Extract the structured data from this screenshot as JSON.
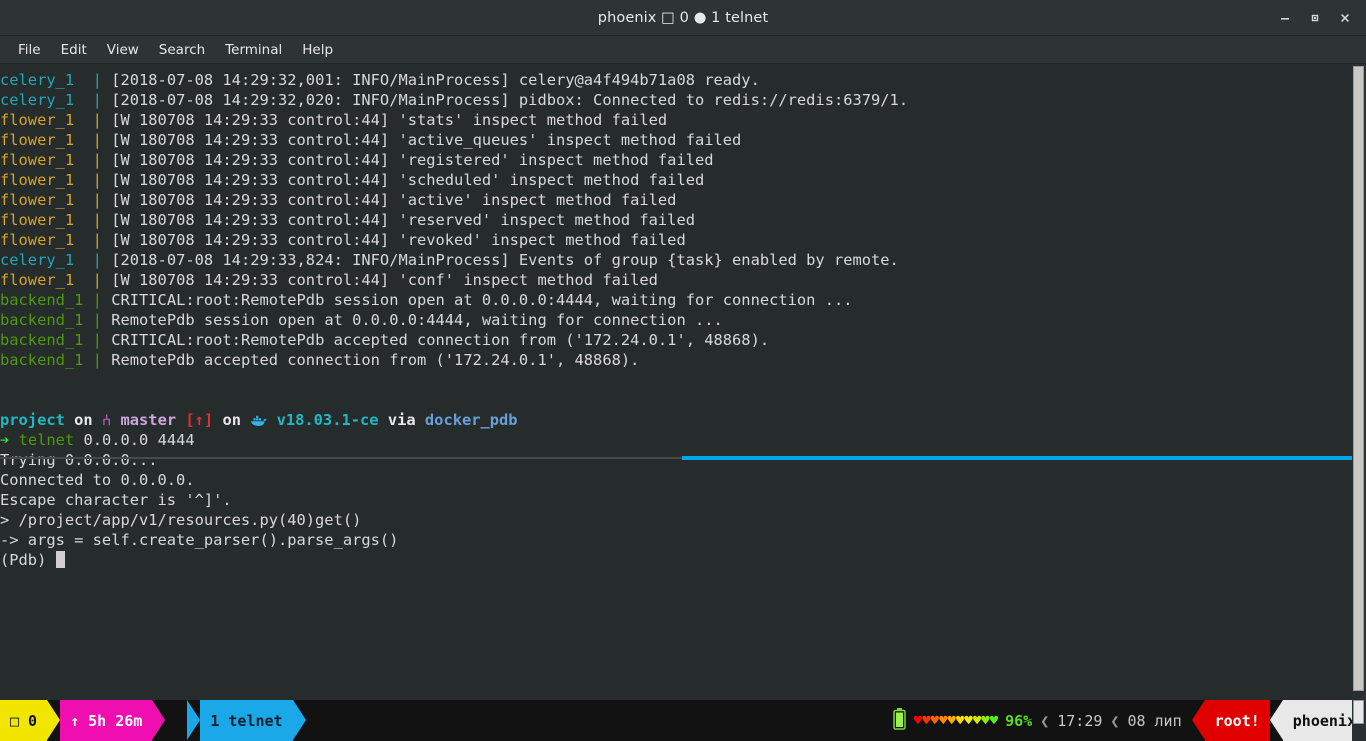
{
  "window": {
    "title": "phoenix □ 0 ● 1 telnet",
    "minimize_label": "–",
    "maximize_label": "□",
    "close_label": "✕"
  },
  "menubar": {
    "items": [
      {
        "label": "File"
      },
      {
        "label": "Edit"
      },
      {
        "label": "View"
      },
      {
        "label": "Search"
      },
      {
        "label": "Terminal"
      },
      {
        "label": "Help"
      }
    ]
  },
  "terminal": {
    "log_lines": [
      {
        "service": "celery_1",
        "service_class": "c-celery",
        "pipe": "|",
        "text": "[2018-07-08 14:29:32,001: INFO/MainProcess] celery@a4f494b71a08 ready."
      },
      {
        "service": "celery_1",
        "service_class": "c-celery",
        "pipe": "|",
        "text": "[2018-07-08 14:29:32,020: INFO/MainProcess] pidbox: Connected to redis://redis:6379/1."
      },
      {
        "service": "flower_1",
        "service_class": "c-flower",
        "pipe": "|",
        "text": "[W 180708 14:29:33 control:44] 'stats' inspect method failed"
      },
      {
        "service": "flower_1",
        "service_class": "c-flower",
        "pipe": "|",
        "text": "[W 180708 14:29:33 control:44] 'active_queues' inspect method failed"
      },
      {
        "service": "flower_1",
        "service_class": "c-flower",
        "pipe": "|",
        "text": "[W 180708 14:29:33 control:44] 'registered' inspect method failed"
      },
      {
        "service": "flower_1",
        "service_class": "c-flower",
        "pipe": "|",
        "text": "[W 180708 14:29:33 control:44] 'scheduled' inspect method failed"
      },
      {
        "service": "flower_1",
        "service_class": "c-flower",
        "pipe": "|",
        "text": "[W 180708 14:29:33 control:44] 'active' inspect method failed"
      },
      {
        "service": "flower_1",
        "service_class": "c-flower",
        "pipe": "|",
        "text": "[W 180708 14:29:33 control:44] 'reserved' inspect method failed"
      },
      {
        "service": "flower_1",
        "service_class": "c-flower",
        "pipe": "|",
        "text": "[W 180708 14:29:33 control:44] 'revoked' inspect method failed"
      },
      {
        "service": "celery_1",
        "service_class": "c-celery",
        "pipe": "|",
        "text": "[2018-07-08 14:29:33,824: INFO/MainProcess] Events of group {task} enabled by remote."
      },
      {
        "service": "flower_1",
        "service_class": "c-flower",
        "pipe": "|",
        "text": "[W 180708 14:29:33 control:44] 'conf' inspect method failed"
      },
      {
        "service": "backend_1",
        "service_class": "c-backend",
        "pipe": "|",
        "text": "CRITICAL:root:RemotePdb session open at 0.0.0.0:4444, waiting for connection ..."
      },
      {
        "service": "backend_1",
        "service_class": "c-backend",
        "pipe": "|",
        "text": "RemotePdb session open at 0.0.0.0:4444, waiting for connection ..."
      },
      {
        "service": "backend_1",
        "service_class": "c-backend",
        "pipe": "|",
        "text": "CRITICAL:root:RemotePdb accepted connection from ('172.24.0.1', 48868)."
      },
      {
        "service": "backend_1",
        "service_class": "c-backend",
        "pipe": "|",
        "text": "RemotePdb accepted connection from ('172.24.0.1', 48868)."
      }
    ],
    "prompt": {
      "dir": "project",
      "on1": "on",
      "branch_icon": "⑃",
      "branch": "master",
      "dirty": "[↑]",
      "on2": "on",
      "docker_icon": "docker-whale-icon",
      "docker_version": "v18.03.1-ce",
      "via": "via",
      "venv": "docker_pdb"
    },
    "command_line": {
      "arrow": "➔",
      "command": "telnet",
      "args": "0.0.0.0 4444"
    },
    "output_lines": [
      "Trying 0.0.0.0...",
      "Connected to 0.0.0.0.",
      "Escape character is '^]'.",
      "> /project/app/v1/resources.py(40)get()",
      "-> args = self.create_parser().parse_args()"
    ],
    "pdb_prompt": "(Pdb) "
  },
  "statusbar": {
    "window_index": "□ 0",
    "uptime": "↑ 5h 26m",
    "session": "1 telnet",
    "battery_icon": "battery-icon",
    "hearts": [
      {
        "color": "#ff0000"
      },
      {
        "color": "#ff3300"
      },
      {
        "color": "#ff6600"
      },
      {
        "color": "#ff8800"
      },
      {
        "color": "#ffaa00"
      },
      {
        "color": "#ffdd00"
      },
      {
        "color": "#eeee00"
      },
      {
        "color": "#ccee00"
      },
      {
        "color": "#88ee11"
      },
      {
        "color": "#55ee22"
      }
    ],
    "battery_percent": "96%",
    "chevron": "❮",
    "time": "17:29",
    "date": "08 лип",
    "user": "root!",
    "host": "phoenix"
  }
}
